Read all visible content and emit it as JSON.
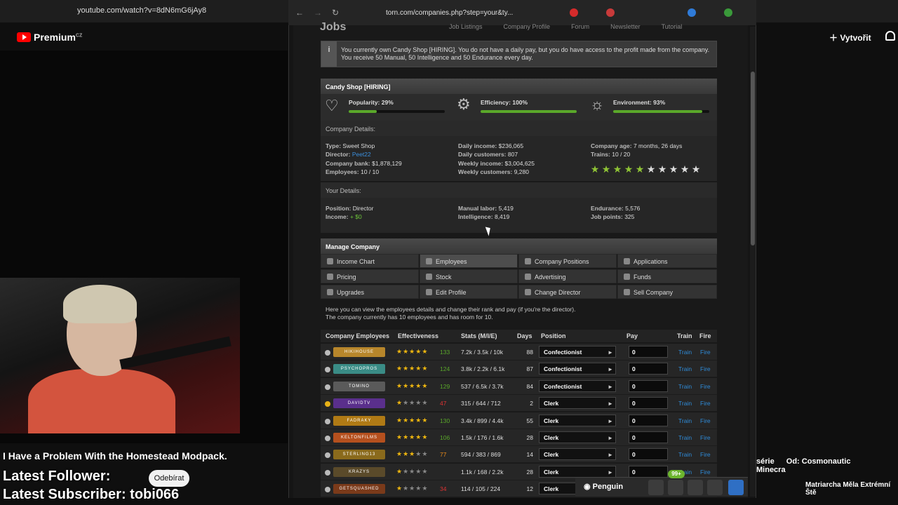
{
  "youtube": {
    "url": "youtube.com/watch?v=8dN6mG6jAy8",
    "logo": "Premium",
    "region": "CZ",
    "create_label": "Vytvořit",
    "video_title": "I Have a Problem With the Homestead Modpack.",
    "overlay_follower": "Latest Follower:",
    "overlay_subscriber": "Latest Subscriber: tobi066",
    "subscribe_label": "Odebírat",
    "chips": [
      "série",
      "Od: Cosmonautic",
      "Minecra"
    ],
    "recommended_title": "Matriarcha Měla Extrémní Ště"
  },
  "torn": {
    "url": "torn.com/companies.php?step=your&ty...",
    "heading": "Jobs",
    "top_nav": [
      "Job Listings",
      "Company Profile",
      "Forum",
      "Newsletter",
      "Tutorial"
    ],
    "info_text": "You currently own Candy Shop [HIRING]. You do not have a daily pay, but you do have access to the profit made from the company. You receive 50 Manual, 50 Intelligence and 50 Endurance every day.",
    "company_name": "Candy Shop [HIRING]",
    "meters": [
      {
        "label": "Popularity: 29%",
        "value": 0.29,
        "icon": "heart-icon"
      },
      {
        "label": "Efficiency: 100%",
        "value": 1.0,
        "icon": "gears-icon"
      },
      {
        "label": "Environment: 93%",
        "value": 0.93,
        "icon": "sun-icon"
      }
    ],
    "company_details_label": "Company Details:",
    "details": {
      "type_label": "Type:",
      "type": "Sweet Shop",
      "director_label": "Director:",
      "director": "Peet22",
      "bank_label": "Company bank:",
      "bank": "$1,878,129",
      "employees_label": "Employees:",
      "employees": "10 / 10",
      "daily_income_label": "Daily income:",
      "daily_income": "$236,065",
      "daily_customers_label": "Daily customers:",
      "daily_customers": "807",
      "weekly_income_label": "Weekly income:",
      "weekly_income": "$3,004,625",
      "weekly_customers_label": "Weekly customers:",
      "weekly_customers": "9,280",
      "age_label": "Company age:",
      "age": "7 months, 26 days",
      "trains_label": "Trains:",
      "trains": "10 / 20",
      "rating": 5,
      "rating_max": 10
    },
    "your_details_label": "Your Details:",
    "your": {
      "position_label": "Position:",
      "position": "Director",
      "income_label": "Income:",
      "income": "+ $0",
      "manual_label": "Manual labor:",
      "manual": "5,419",
      "intel_label": "Intelligence:",
      "intel": "8,419",
      "endurance_label": "Endurance:",
      "endurance": "5,576",
      "jobpoints_label": "Job points:",
      "jobpoints": "325"
    },
    "manage_label": "Manage Company",
    "manage_items": [
      "Income Chart",
      "Employees",
      "Company Positions",
      "Applications",
      "Pricing",
      "Stock",
      "Advertising",
      "Funds",
      "Upgrades",
      "Edit Profile",
      "Change Director",
      "Sell Company"
    ],
    "employees_desc_1": "Here you can view the employees details and change their rank and pay (if you're the director).",
    "employees_desc_2": "The company currently has 10 employees and has room for 10.",
    "table_headers": [
      "Company Employees",
      "Effectiveness",
      "Stats (M/I/E)",
      "Days",
      "Position",
      "Pay",
      "Train",
      "Fire"
    ],
    "employees_list": [
      {
        "name": "HIKIHOUSE",
        "stars": 5,
        "eff": "133",
        "stats": "7.2k / 3.5k / 10k",
        "days": "88",
        "position": "Confectionist",
        "pay": "0",
        "color": "#b7862b",
        "effcolor": "#5aa82a",
        "idle": false
      },
      {
        "name": "PSYCHOPROS",
        "stars": 5,
        "eff": "124",
        "stats": "3.8k / 2.2k / 6.1k",
        "days": "87",
        "position": "Confectionist",
        "pay": "0",
        "color": "#3a8c86",
        "effcolor": "#5aa82a",
        "idle": false
      },
      {
        "name": "TOMINO",
        "stars": 5,
        "eff": "129",
        "stats": "537 / 6.5k / 3.7k",
        "days": "84",
        "position": "Confectionist",
        "pay": "0",
        "color": "#5a5a5a",
        "effcolor": "#5aa82a",
        "idle": false
      },
      {
        "name": "DAVIDTV",
        "stars": 1,
        "eff": "47",
        "stats": "315 / 644 / 712",
        "days": "2",
        "position": "Clerk",
        "pay": "0",
        "color": "#5a2f8c",
        "effcolor": "#d33",
        "idle": true
      },
      {
        "name": "FADRAKY",
        "stars": 5,
        "eff": "130",
        "stats": "3.4k / 899 / 4.4k",
        "days": "55",
        "position": "Clerk",
        "pay": "0",
        "color": "#b07a15",
        "effcolor": "#5aa82a",
        "idle": false
      },
      {
        "name": "KELTONFILMS",
        "stars": 5,
        "eff": "106",
        "stats": "1.5k / 176 / 1.6k",
        "days": "28",
        "position": "Clerk",
        "pay": "0",
        "color": "#b5501e",
        "effcolor": "#5aa82a",
        "idle": false
      },
      {
        "name": "STERLING13",
        "stars": 3,
        "eff": "77",
        "stats": "594 / 383 / 869",
        "days": "14",
        "position": "Clerk",
        "pay": "0",
        "color": "#8a6a1c",
        "effcolor": "#e88a1a",
        "idle": false
      },
      {
        "name": "KRAZYS",
        "stars": 1,
        "eff": "",
        "stats": "1.1k / 168 / 2.2k",
        "days": "28",
        "position": "Clerk",
        "pay": "0",
        "color": "#5a4a2a",
        "effcolor": "#d33",
        "idle": false
      },
      {
        "name": "GETSQUASHED",
        "stars": 1,
        "eff": "34",
        "stats": "114 / 105 / 224",
        "days": "12",
        "position": "Clerk",
        "pay": "0",
        "color": "#7a3a1a",
        "effcolor": "#d33",
        "idle": false
      }
    ],
    "train_label": "Train",
    "fire_label": "Fire",
    "dock_label": "Penguin",
    "dock_badge": "99+"
  }
}
